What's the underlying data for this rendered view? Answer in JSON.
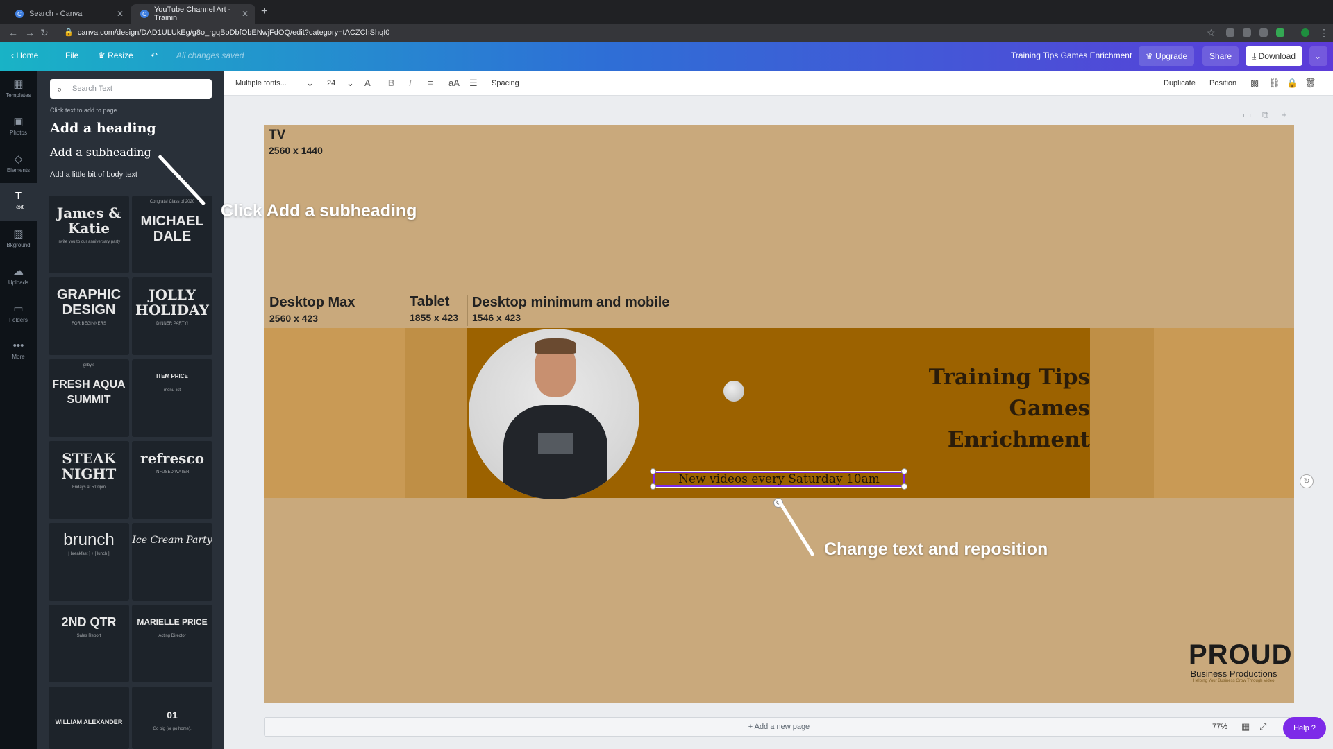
{
  "browser": {
    "tabs": [
      {
        "title": "Search - Canva"
      },
      {
        "title": "YouTube Channel Art - Trainin"
      }
    ],
    "url": "canva.com/design/DAD1ULUkEg/g8o_rgqBoDbfObENwjFdOQ/edit?category=tACZChShqI0"
  },
  "topbar": {
    "home": "Home",
    "file": "File",
    "resize": "Resize",
    "saved_status": "All changes saved",
    "design_title": "Training Tips Games Enrichment",
    "upgrade": "Upgrade",
    "share": "Share",
    "download": "Download"
  },
  "rail": [
    {
      "label": "Templates",
      "icon": "template-icon"
    },
    {
      "label": "Photos",
      "icon": "photo-icon"
    },
    {
      "label": "Elements",
      "icon": "elements-icon"
    },
    {
      "label": "Text",
      "icon": "text-icon"
    },
    {
      "label": "Bkground",
      "icon": "background-icon"
    },
    {
      "label": "Uploads",
      "icon": "upload-icon"
    },
    {
      "label": "Folders",
      "icon": "folder-icon"
    },
    {
      "label": "More",
      "icon": "more-icon"
    }
  ],
  "panel": {
    "search_placeholder": "Search Text",
    "hint": "Click text to add to page",
    "add_heading": "Add a heading",
    "add_subheading": "Add a subheading",
    "add_body": "Add a little bit of body text",
    "templates": [
      {
        "title": "James & Katie",
        "sub": "Invite you to our anniversary party"
      },
      {
        "title": "MICHAEL DALE",
        "sub": "Congrats! Class of 2020"
      },
      {
        "title": "GRAPHIC DESIGN",
        "sub": "FOR BEGINNERS"
      },
      {
        "title": "JOLLY HOLIDAY",
        "sub": "DINNER PARTY!"
      },
      {
        "title": "FRESH AQUA SUMMIT",
        "sub": "gilby's"
      },
      {
        "title": "ITEM  PRICE",
        "sub": "menu list"
      },
      {
        "title": "STEAK NIGHT",
        "sub": "Fridays at 5:00pm"
      },
      {
        "title": "refresco",
        "sub": "INFUSED WATER"
      },
      {
        "title": "brunch",
        "sub": "[ breakfast ] + [ lunch ]"
      },
      {
        "title": "Ice Cream Party",
        "sub": ""
      },
      {
        "title": "2ND QTR",
        "sub": "Sales Report"
      },
      {
        "title": "MARIELLE PRICE",
        "sub": "Acting Director"
      },
      {
        "title": "WILLIAM ALEXANDER",
        "sub": ""
      },
      {
        "title": "01",
        "sub": "Go big (or go home)."
      }
    ]
  },
  "toolbar": {
    "font": "Multiple fonts...",
    "size": "24",
    "spacing": "Spacing",
    "duplicate": "Duplicate",
    "position": "Position"
  },
  "canvas": {
    "tv_label": "TV",
    "tv_size": "2560 x 1440",
    "desktop_max_label": "Desktop Max",
    "desktop_max_size": "2560 x 423",
    "tablet_label": "Tablet",
    "tablet_size": "1855 x 423",
    "mobile_label": "Desktop minimum and mobile",
    "mobile_size": "1546 x 423",
    "title_lines": [
      "Training Tips",
      "Games",
      "Enrichment"
    ],
    "selected_text": "New videos every Saturday 10am",
    "logo_big": "PROUD",
    "logo_small": "Business Productions",
    "logo_tagline": "Helping Your Business Grow Through Video"
  },
  "annotations": {
    "click_sub": "Click Add a subheading",
    "change_text": "Change text and reposition"
  },
  "bottom": {
    "add_page": "+ Add a new page",
    "zoom": "77%",
    "help": "Help ?"
  },
  "colors": {
    "canvas_bg": "#c9a97c",
    "band_dark": "#9c6200",
    "accent": "#7d2ae8"
  }
}
